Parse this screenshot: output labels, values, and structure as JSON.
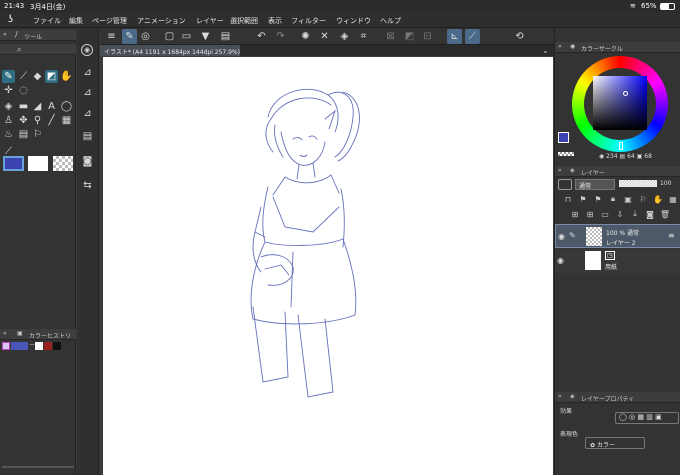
{
  "status": {
    "time": "21:43",
    "date": "3月4日(金)",
    "battery": "65%"
  },
  "menu": [
    "ファイル",
    "編集",
    "ページ管理",
    "アニメーション",
    "レイヤー",
    "選択範囲",
    "表示",
    "フィルター",
    "ウィンドウ",
    "ヘルプ"
  ],
  "tool_panel": {
    "title": "ツール"
  },
  "color_history": {
    "title": "カラーヒストリー",
    "colors": [
      "#d9c6f0",
      "#4a56b8",
      "#ffffff",
      "#9a2020",
      "#ffffff",
      "#111111"
    ]
  },
  "document": {
    "tab_label": "イラスト* (A4 1191 x 1684px 144dpi 257.9%)"
  },
  "color_wheel": {
    "title": "カラーサークル",
    "values": [
      "234",
      "64",
      "68"
    ],
    "main_color": "#3b43b0"
  },
  "layer_panel": {
    "title": "レイヤー",
    "blend_mode": "通常",
    "opacity": "100",
    "layers": [
      {
        "line1": "100 % 通常",
        "line2": "レイヤー 2"
      },
      {
        "line1": "",
        "line2": "用紙"
      }
    ]
  },
  "layer_property": {
    "title": "レイヤープロパティ",
    "effect_label": "効果",
    "display_color_label": "表現色",
    "display_color_value": "カラー"
  }
}
